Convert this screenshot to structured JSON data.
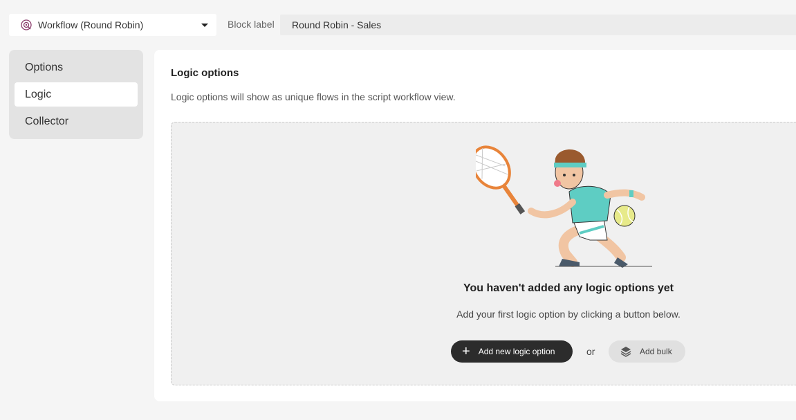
{
  "header": {
    "block_type": "Workflow (Round Robin)",
    "block_label_text": "Block label",
    "block_label_value": "Round Robin - Sales"
  },
  "sidebar": {
    "items": [
      {
        "label": "Options",
        "active": false
      },
      {
        "label": "Logic",
        "active": true
      },
      {
        "label": "Collector",
        "active": false
      }
    ]
  },
  "main": {
    "title": "Logic options",
    "description": "Logic options will show as unique flows in the script workflow view.",
    "empty_state": {
      "title": "You haven't added any logic options yet",
      "subtitle": "Add your first logic option by clicking a button below.",
      "add_button": "Add new logic option",
      "or_text": "or",
      "bulk_button": "Add bulk"
    }
  },
  "icons": {
    "block_type": "workflow-target-icon",
    "dropdown": "chevron-down-icon",
    "add": "plus-icon",
    "bulk": "layers-icon",
    "illustration": "tennis-player-illustration"
  },
  "colors": {
    "accent_dark": "#2c2c2c",
    "workflow_icon": "#8a3a6b"
  }
}
